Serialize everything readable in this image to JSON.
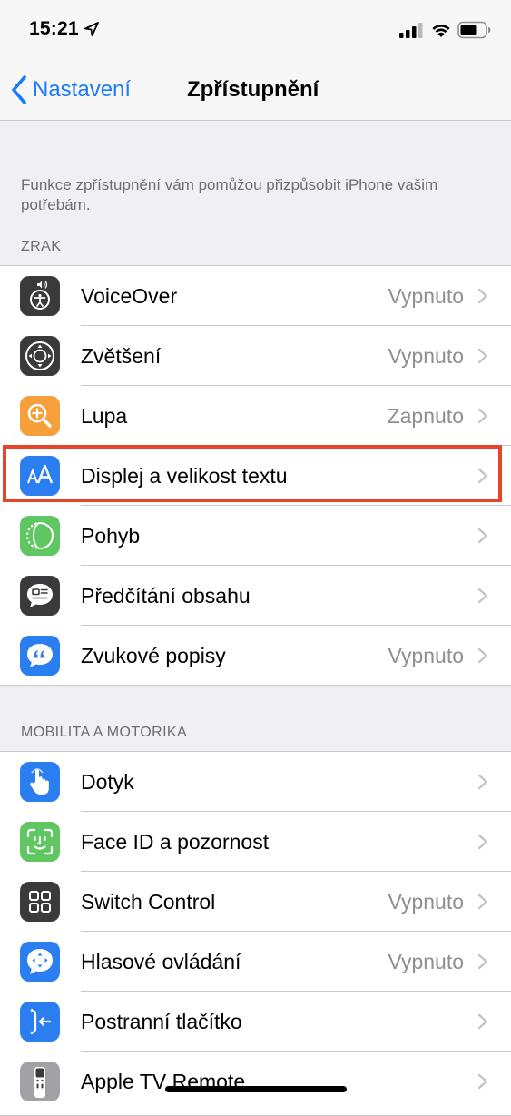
{
  "status_bar": {
    "time": "15:21",
    "location_icon": "location-arrow-icon",
    "signal_icon": "cellular-signal-icon",
    "wifi_icon": "wifi-icon",
    "battery_icon": "battery-icon"
  },
  "nav": {
    "back_label": "Nastavení",
    "title": "Zpřístupnění"
  },
  "intro_text": "Funkce zpřístupnění vám pomůžou přizpůsobit iPhone vašim potřebám.",
  "sections": {
    "vision": {
      "header": "ZRAK",
      "items": [
        {
          "label": "VoiceOver",
          "value": "Vypnuto",
          "icon": "voiceover-icon"
        },
        {
          "label": "Zvětšení",
          "value": "Vypnuto",
          "icon": "zoom-icon"
        },
        {
          "label": "Lupa",
          "value": "Zapnuto",
          "icon": "magnifier-icon"
        },
        {
          "label": "Displej a velikost textu",
          "value": "",
          "icon": "display-text-size-icon"
        },
        {
          "label": "Pohyb",
          "value": "",
          "icon": "motion-icon"
        },
        {
          "label": "Předčítání obsahu",
          "value": "",
          "icon": "spoken-content-icon"
        },
        {
          "label": "Zvukové popisy",
          "value": "Vypnuto",
          "icon": "audio-descriptions-icon"
        }
      ]
    },
    "mobility": {
      "header": "MOBILITA A MOTORIKA",
      "items": [
        {
          "label": "Dotyk",
          "value": "",
          "icon": "touch-icon"
        },
        {
          "label": "Face ID a pozornost",
          "value": "",
          "icon": "face-id-icon"
        },
        {
          "label": "Switch Control",
          "value": "Vypnuto",
          "icon": "switch-control-icon"
        },
        {
          "label": "Hlasové ovládání",
          "value": "Vypnuto",
          "icon": "voice-control-icon"
        },
        {
          "label": "Postranní tlačítko",
          "value": "",
          "icon": "side-button-icon"
        },
        {
          "label": "Apple TV Remote",
          "value": "",
          "icon": "apple-tv-remote-icon"
        }
      ]
    }
  },
  "colors": {
    "accent_blue": "#1a7bfa",
    "highlight_red": "#e8442b",
    "icon_dark_gray": "#3a3a3c",
    "icon_orange": "#f5a03a",
    "icon_green": "#5fc661",
    "icon_blue": "#2a7ef0",
    "icon_light_gray": "#a2a2a6"
  }
}
